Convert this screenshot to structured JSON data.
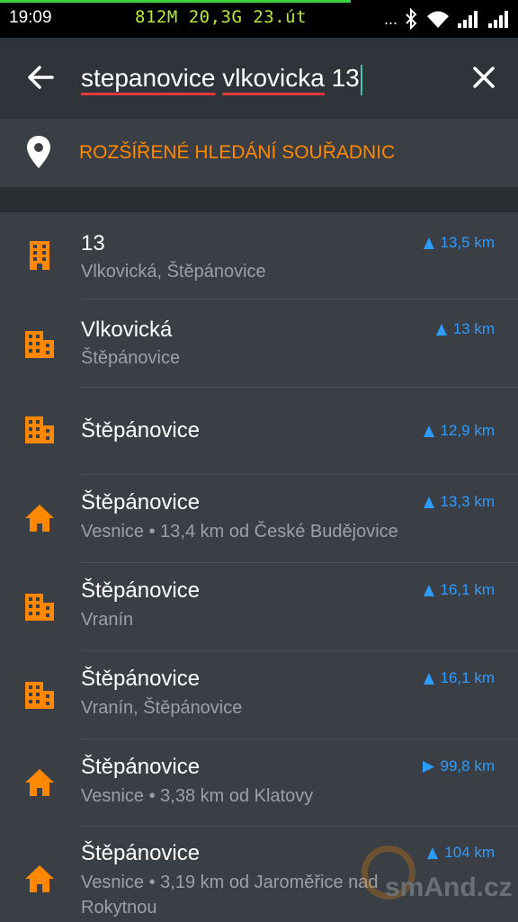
{
  "status_bar": {
    "time": "19:09",
    "net_info": "812M  20,3G 23.út",
    "dots": "...",
    "accent_color": "#3bd13b"
  },
  "search": {
    "query_words": [
      "stepanovice",
      "vlkovicka",
      "13"
    ],
    "back_icon": "arrow-left-icon",
    "clear_icon": "close-icon"
  },
  "coordinate_search": {
    "label": "ROZŠÍŘENÉ HLEDÁNÍ SOUŘADNIC",
    "icon": "map-pin-icon",
    "color": "#ff8800"
  },
  "results": [
    {
      "icon": "building-icon",
      "title": "13",
      "subtitle": "Vlkovická, Štěpánovice",
      "distance": "13,5 km",
      "direction": "up"
    },
    {
      "icon": "city-icon",
      "title": "Vlkovická",
      "subtitle": "Štěpánovice",
      "distance": "13 km",
      "direction": "up"
    },
    {
      "icon": "city-icon",
      "title": "Štěpánovice",
      "subtitle": "",
      "distance": "12,9 km",
      "direction": "up"
    },
    {
      "icon": "house-icon",
      "title": "Štěpánovice",
      "subtitle": "Vesnice • 13,4 km od České Budějovice",
      "distance": "13,3 km",
      "direction": "up"
    },
    {
      "icon": "city-icon",
      "title": "Štěpánovice",
      "subtitle": "Vranín",
      "distance": "16,1 km",
      "direction": "up"
    },
    {
      "icon": "city-icon",
      "title": "Štěpánovice",
      "subtitle": "Vranín, Štěpánovice",
      "distance": "16,1 km",
      "direction": "up"
    },
    {
      "icon": "house-icon",
      "title": "Štěpánovice",
      "subtitle": "Vesnice • 3,38 km od Klatovy",
      "distance": "99,8 km",
      "direction": "right"
    },
    {
      "icon": "house-icon",
      "title": "Štěpánovice",
      "subtitle": "Vesnice • 3,19 km od Jaroměřice nad Rokytnou",
      "distance": "104 km",
      "direction": "up"
    }
  ],
  "watermark": "smAnd.cz",
  "colors": {
    "accent_orange": "#ff8800",
    "distance_blue": "#2e9bff",
    "background": "#2f343a",
    "row_background": "#3a3f45"
  }
}
